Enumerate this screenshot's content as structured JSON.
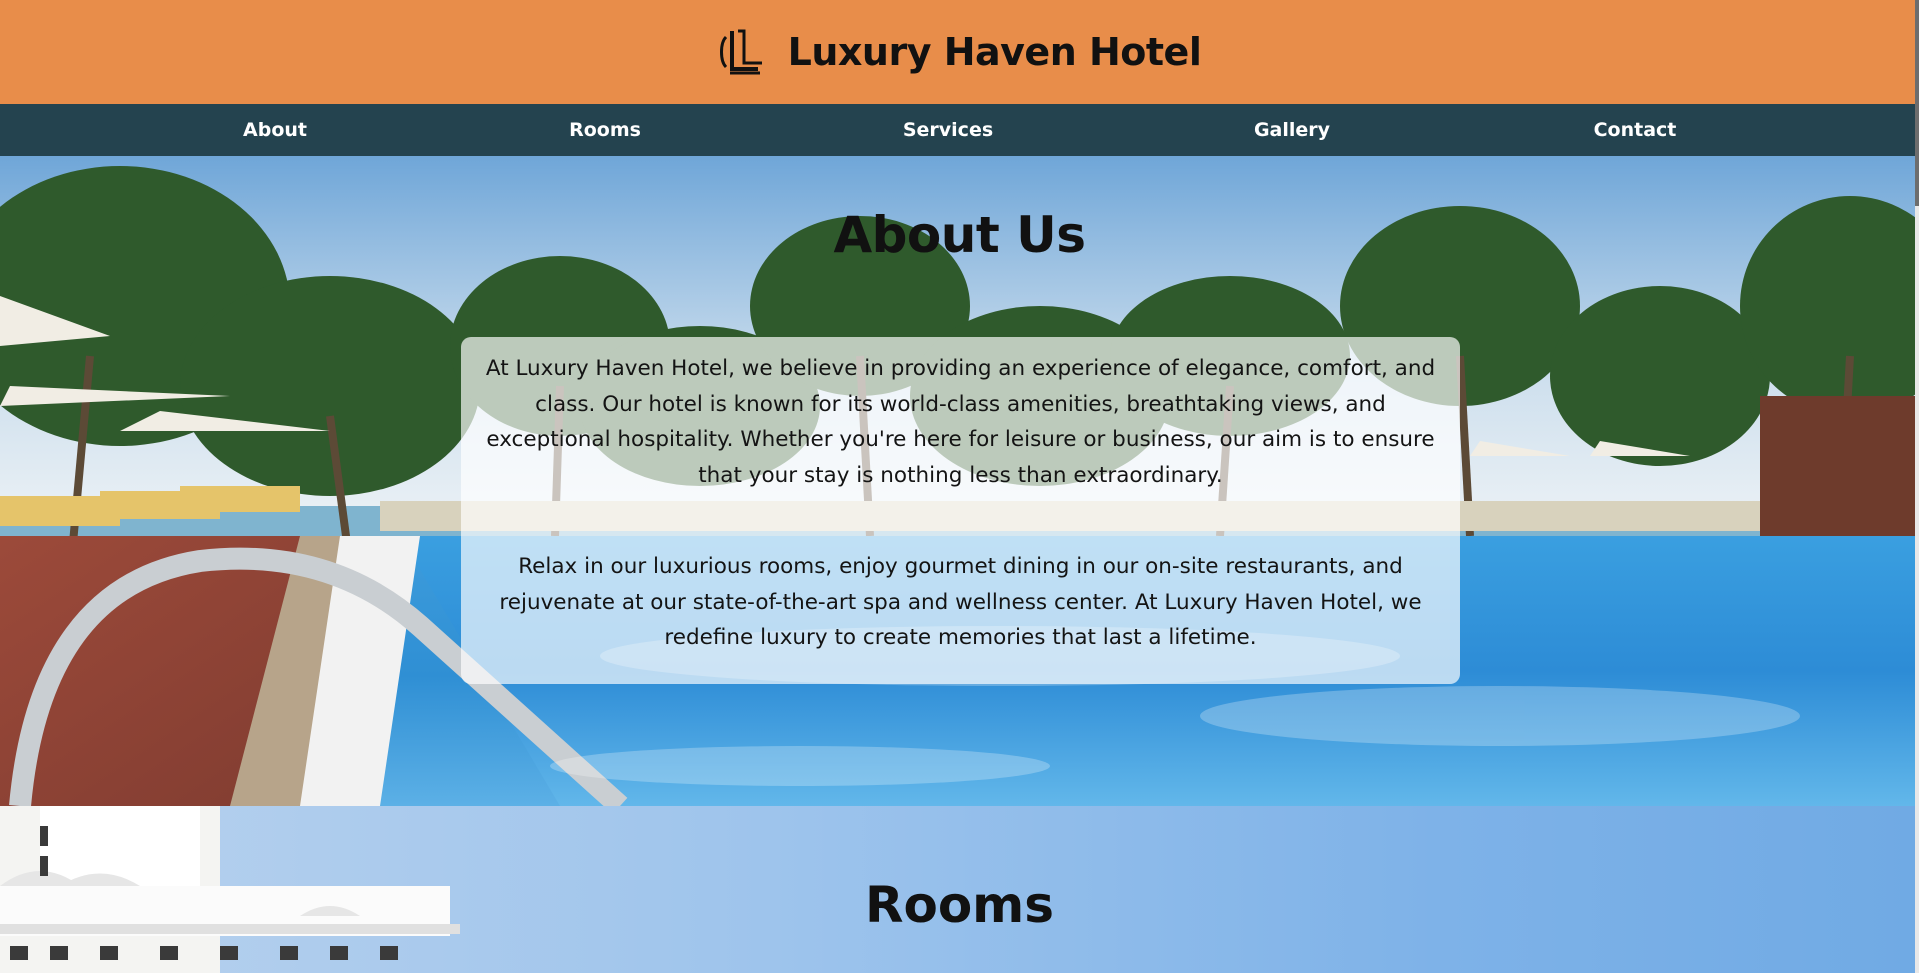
{
  "header": {
    "title": "Luxury Haven Hotel",
    "logo_icon": "hotel-logo-icon",
    "background": "#e88d4a"
  },
  "nav": {
    "background": "#24434f",
    "items": [
      {
        "label": "About"
      },
      {
        "label": "Rooms"
      },
      {
        "label": "Services"
      },
      {
        "label": "Gallery"
      },
      {
        "label": "Contact"
      }
    ]
  },
  "about": {
    "title": "About Us",
    "paragraphs": [
      "At Luxury Haven Hotel, we believe in providing an experience of elegance, comfort, and class. Our hotel is known for its world-class amenities, breathtaking views, and exceptional hospitality. Whether you're here for leisure or business, our aim is to ensure that your stay is nothing less than extraordinary.",
      "Relax in our luxurious rooms, enjoy gourmet dining in our on-site restaurants, and rejuvenate at our state-of-the-art spa and wellness center. At Luxury Haven Hotel, we redefine luxury to create memories that last a lifetime."
    ]
  },
  "rooms": {
    "title": "Rooms"
  }
}
